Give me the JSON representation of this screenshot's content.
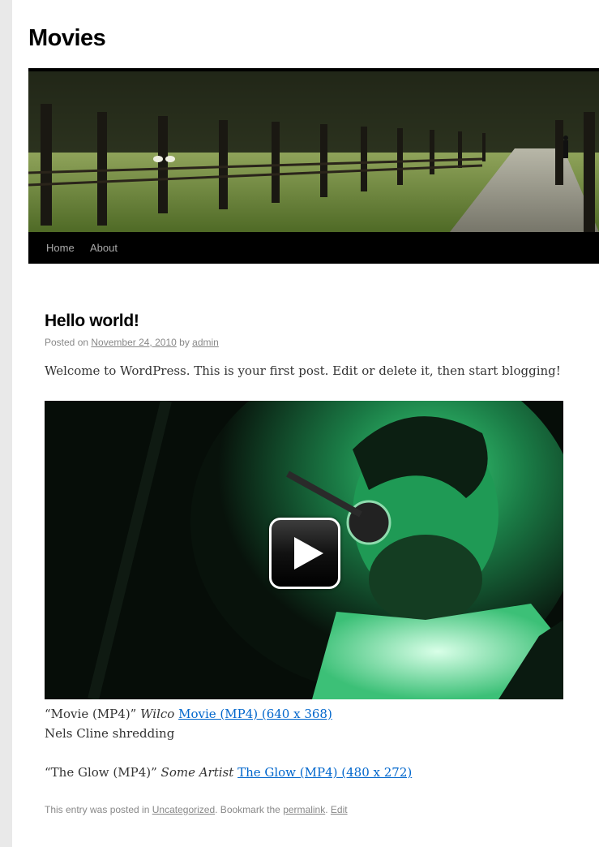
{
  "site": {
    "title": "Movies"
  },
  "nav": {
    "items": [
      {
        "label": "Home"
      },
      {
        "label": "About"
      }
    ]
  },
  "post": {
    "title": "Hello world!",
    "meta": {
      "posted_on": "Posted on",
      "date": "November 24, 2010",
      "by": "by",
      "author": "admin"
    },
    "intro": "Welcome to WordPress. This is your first post. Edit or delete it, then start blogging!",
    "videos": [
      {
        "quoted_title": "“Movie (MP4)”",
        "artist": "Wilco",
        "link": "Movie (MP4) (640 x 368)",
        "caption": "Nels Cline shredding"
      },
      {
        "quoted_title": "“The Glow (MP4)”",
        "artist": "Some Artist",
        "link": "The Glow (MP4) (480 x 272)"
      }
    ],
    "footer": {
      "prefix": "This entry was posted in",
      "category": "Uncategorized",
      "mid": ". Bookmark the",
      "permalink": "permalink",
      "sep": ".",
      "edit": "Edit"
    }
  },
  "colors": {
    "nav_bg": "#000000",
    "link": "#0066cc",
    "meta": "#888888"
  },
  "icons": {
    "video_play": "play-icon"
  }
}
